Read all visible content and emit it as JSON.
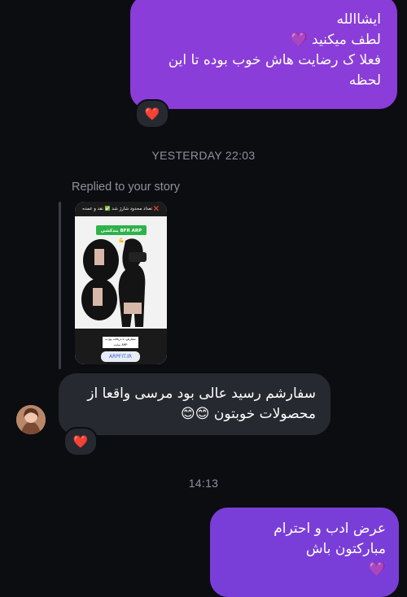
{
  "messages": {
    "outgoing_1": {
      "line1": "ایشاالله",
      "line2": "لطف میکنید 💜",
      "line3": "فعلا ک رضایت هاش خوب بوده تا این",
      "line4": "لحظه",
      "reaction": "❤️"
    },
    "timestamp_1": "YESTERDAY 22:03",
    "story_reply": {
      "label": "Replied to your story",
      "story_banner": "تعداد محدود شارژ شد ✅ نقد و عمده ❌",
      "story_brand": "بندکشی BFR ARP 💪",
      "story_cta": "سفارش، با دریافت پیج به سایت ARP",
      "story_link": "ARPFIT.IR"
    },
    "incoming_1": {
      "line1": "سفارشم رسید عالی بود مرسی واقعا از",
      "line2": "محصولات خوبتون 😊😊",
      "reaction": "❤️"
    },
    "timestamp_2": "14:13",
    "outgoing_2": {
      "line1": "عرض ادب و احترام",
      "line2": "مبارکتون باش",
      "line3": "💜"
    }
  },
  "colors": {
    "background": "#0c0d10",
    "outgoing_bubble": "#8a3dd8",
    "incoming_bubble": "#262a30",
    "heart": "#ff3b5c"
  }
}
